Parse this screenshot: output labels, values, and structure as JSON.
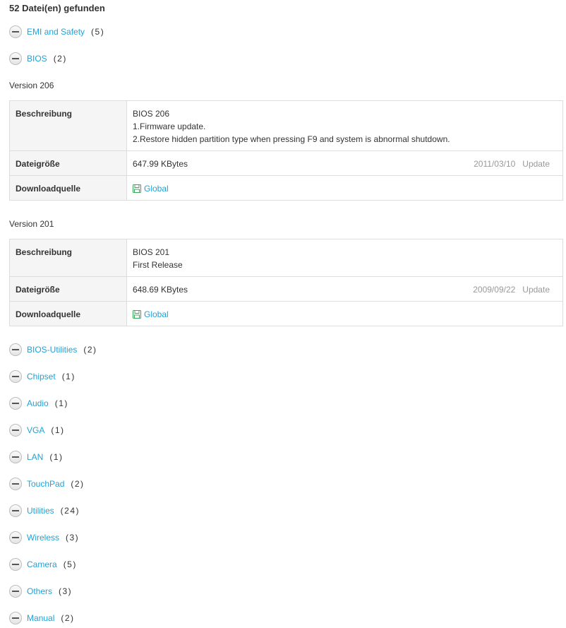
{
  "page": {
    "title": "52 Datei(en) gefunden"
  },
  "categories": [
    {
      "name": "EMI and Safety",
      "count": "(5)"
    },
    {
      "name": "BIOS",
      "count": "(2)"
    },
    {
      "name": "BIOS-Utilities",
      "count": "(2)"
    },
    {
      "name": "Chipset",
      "count": "(1)"
    },
    {
      "name": "Audio",
      "count": "(1)"
    },
    {
      "name": "VGA",
      "count": "(1)"
    },
    {
      "name": "LAN",
      "count": "(1)"
    },
    {
      "name": "TouchPad",
      "count": "(2)"
    },
    {
      "name": "Utilities",
      "count": "(24)"
    },
    {
      "name": "Wireless",
      "count": "(3)"
    },
    {
      "name": "Camera",
      "count": "(5)"
    },
    {
      "name": "Others",
      "count": "(3)"
    },
    {
      "name": "Manual",
      "count": "(2)"
    }
  ],
  "labels": {
    "description": "Beschreibung",
    "filesize": "Dateigröße",
    "source": "Downloadquelle"
  },
  "bios_versions": [
    {
      "version": "Version 206",
      "description_lines": [
        "BIOS 206",
        "1.Firmware update.",
        "2.Restore hidden partition type when pressing F9 and system is abnormal shutdown."
      ],
      "size": "647.99 KBytes",
      "date": "2011/03/10",
      "update": "Update",
      "download": "Global"
    },
    {
      "version": "Version 201",
      "description_lines": [
        "BIOS 201",
        "First Release"
      ],
      "size": "648.69 KBytes",
      "date": "2009/09/22",
      "update": "Update",
      "download": "Global"
    }
  ],
  "colors": {
    "link": "#1ea3d9",
    "download_icon": "#3aa65a",
    "muted": "#999999",
    "label_bg": "#f5f5f5",
    "border": "#dddddd"
  },
  "icons": {
    "toggle": "minus-circle-icon",
    "download": "floppy-disk-icon"
  }
}
